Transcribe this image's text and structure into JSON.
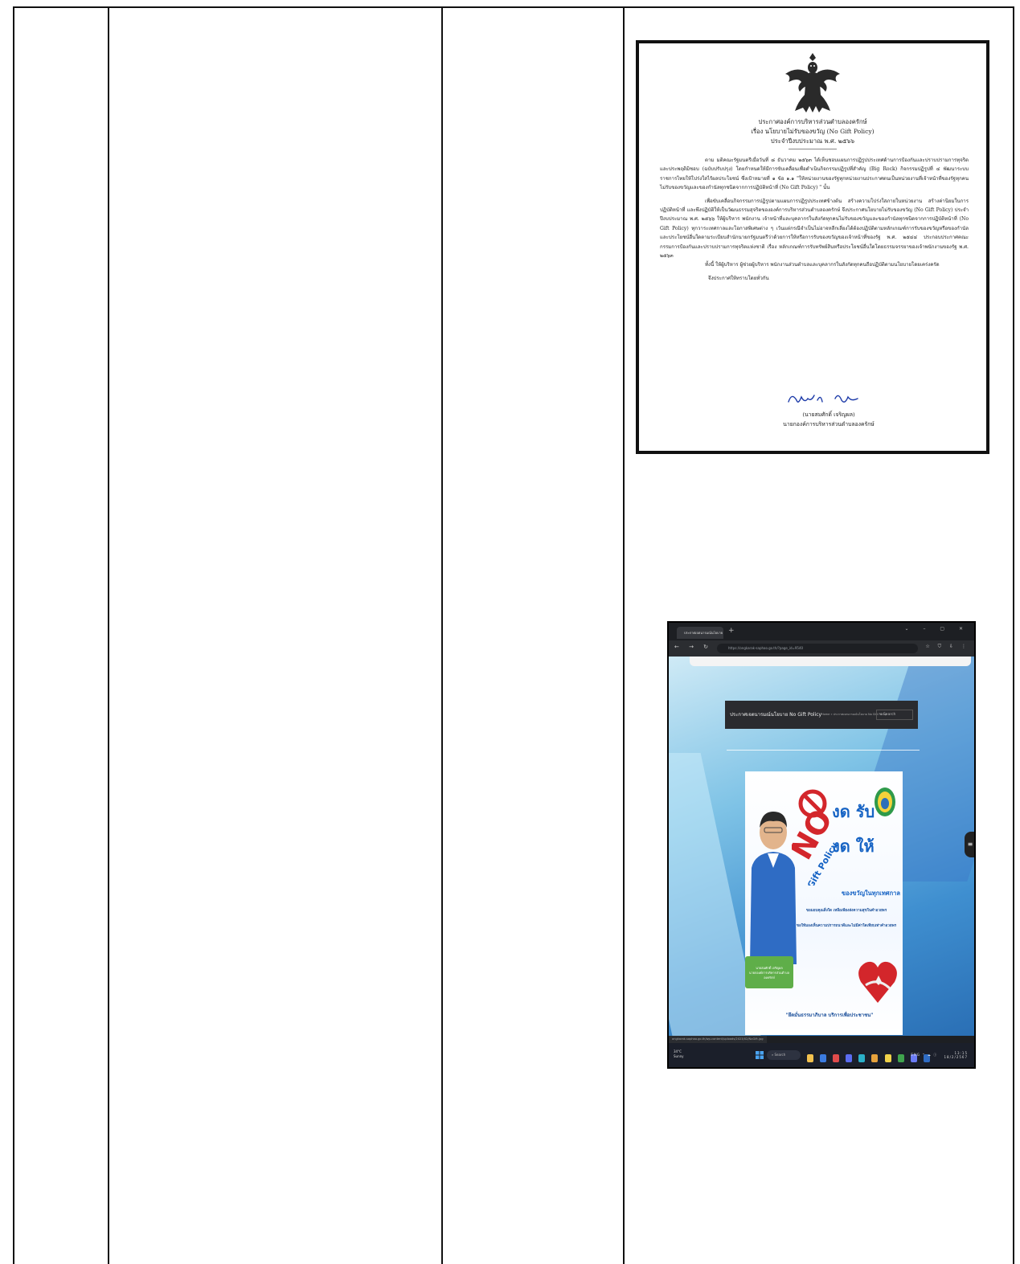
{
  "announcement": {
    "heading_lines": [
      "ประกาศองค์การบริหารส่วนตำบลองครักษ์",
      "เรื่อง  นโยบายไม่รับของขวัญ (No Gift Policy)",
      "ประจำปีงบประมาณ พ.ศ. ๒๕๖๖"
    ],
    "paragraph_1": "ตาม มติคณะรัฐมนตรีเมื่อวันที่ ๘ ธันวาคม ๒๕๖๓ ได้เห็นชอบแผนการปฏิรูปประเทศด้านการป้องกันและปราบปรามการทุจริตและประพฤติมิชอบ (ฉบับปรับปรุง) โดยกำหนดให้มีการขับเคลื่อนเพื่อดำเนินกิจกรรมปฏิรูปที่สำคัญ (Big Rock) กิจกรรมปฏิรูปที่ ๔ พัฒนาระบบราชการไทยให้โปร่งใสไร้ผลประโยชน์ ซึ่งเป้าหมายที่ ๑ ข้อ ๑.๑ \"ให้หน่วยงานของรัฐทุกหน่วยงานประกาศตนเป็นหน่วยงานที่เจ้าหน้าที่ของรัฐทุกคนไม่รับของขวัญและของกำนัลทุกชนิดจากการปฏิบัติหน้าที่ (No Gift Policy) \" นั้น",
    "paragraph_2": "เพื่อขับเคลื่อนกิจกรรมการปฏิรูปตามแผนการปฏิรูปประเทศข้างต้น สร้างความโปร่งใสภายในหน่วยงาน สร้างค่านิยมในการปฏิบัติหน้าที่ และพึงปฏิบัติให้เป็นวัฒนธรรมสุจริตขององค์การบริหารส่วนตำบลองครักษ์ จึงประกาศนโยบายไม่รับของขวัญ (No Gift Policy) ประจำปีงบประมาณ พ.ศ. ๒๕๖๖ ให้ผู้บริหาร พนักงาน เจ้าหน้าที่และบุคลากรในสังกัดทุกคนไม่รับของขวัญและของกำนัลทุกชนิดจากการปฏิบัติหน้าที่ (No Gift Policy) ทุกวาระเทศกาลและโอกาสพิเศษต่าง ๆ เว้นแต่กรณีจำเป็นไม่อาจหลีกเลี่ยงได้ต้องปฏิบัติตามหลักเกณฑ์การรับของขวัญหรือของกำนัล และประโยชน์อื่นใดตามระเบียบสำนักนายกรัฐมนตรีว่าด้วยการให้หรือการรับของขวัญของเจ้าหน้าที่ของรัฐ พ.ศ. ๒๕๔๔ ประกอบประกาศคณะกรรมการป้องกันและปราบปรามการทุจริตแห่งชาติ เรื่อง หลักเกณฑ์การรับทรัพย์สินหรือประโยชน์อื่นใดโดยธรรมจรรยาของเจ้าพนักงานของรัฐ พ.ศ. ๒๕๖๓",
    "paragraph_3": "ทั้งนี้ ให้ผู้บริหาร ผู้ช่วยผู้บริหาร พนักงานส่วนตำบลและบุคลากรในสังกัดทุกคนถือปฏิบัติตามนโยบายโดยเคร่งครัด",
    "closing": "จึงประกาศให้ทราบโดยทั่วกัน",
    "signer_name": "(นายสมศักดิ์  เจริญผล)",
    "signer_title": "นายกองค์การบริหารส่วนตำบลองครักษ์"
  },
  "screenshot": {
    "tab_title": "ประกาศเจตนารมณ์นโยบาย No Gift",
    "url": "https://ongkarak-saphao.go.th/?page_id=9540",
    "page_title": "ประกาศเจตนารมณ์นโยบาย No Gift Policy",
    "breadcrumb": "Home » ประกาศเจตนารมณ์นโยบาย No Gift Policy",
    "search_placeholder": "Search",
    "poster": {
      "headline_line1": "งด รับ",
      "headline_line2": "งด ให้",
      "badge_big": "NO",
      "badge_small": "Gift Policy",
      "subline": "ของขวัญในทุกเทศกาล",
      "message_1": "ขอมอบคุณสิ่งใด เหลือเพียงส่งความสุขในคำอวยพร",
      "message_2": "ขอให้มองเห็นความปรารถนาดีและไม่มีค่าใดเทียบเท่าคำอวยพร",
      "name_line1": "นายสมศักดิ์  เจริญผล",
      "name_line2": "นายกองค์การบริหารส่วนตำบลองครักษ์",
      "slogan": "\"ยึดมั่นธรรมาภิบาล บริการเพื่อประชาชน\""
    },
    "status_url": "ongkarak-saphao.go.th/wp-content/uploads/2023/02/NoGift.jpg",
    "taskbar": {
      "weather_temp": "34°C",
      "weather_desc": "Sunny",
      "search_label": "Search",
      "tray_text": "ENG  ⌃  ☁  ⓘ",
      "time": "13:15",
      "date": "18/2/2567"
    }
  }
}
